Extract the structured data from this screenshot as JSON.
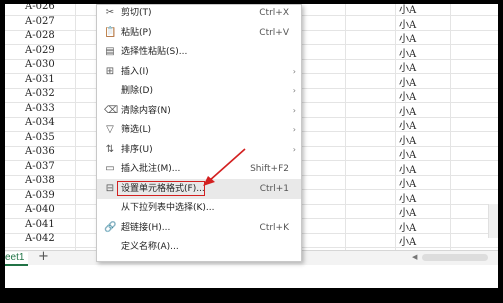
{
  "sheet": {
    "rows": [
      {
        "a": "A-026",
        "g": "小A"
      },
      {
        "a": "A-027",
        "g": "小A"
      },
      {
        "a": "A-028",
        "g": "小A"
      },
      {
        "a": "A-029",
        "g": "小A"
      },
      {
        "a": "A-030",
        "g": "小A"
      },
      {
        "a": "A-031",
        "g": "小A"
      },
      {
        "a": "A-032",
        "g": "小A"
      },
      {
        "a": "A-033",
        "g": "小A"
      },
      {
        "a": "A-034",
        "g": "小A"
      },
      {
        "a": "A-035",
        "g": "小A"
      },
      {
        "a": "A-036",
        "g": "小A"
      },
      {
        "a": "A-037",
        "g": "小A"
      },
      {
        "a": "A-038",
        "g": "小A"
      },
      {
        "a": "A-039",
        "g": "小A"
      },
      {
        "a": "A-040",
        "g": "小A"
      },
      {
        "a": "A-041",
        "g": "小A"
      },
      {
        "a": "A-042",
        "g": "小A"
      }
    ],
    "tab_label": "eet1",
    "add_sheet": "+"
  },
  "menu": {
    "items": [
      {
        "icon": "✂",
        "icon_name": "scissors-icon",
        "label": "剪切(T)",
        "shortcut": "Ctrl+X",
        "arrow": ""
      },
      {
        "icon": "📋",
        "icon_name": "clipboard-icon",
        "label": "粘贴(P)",
        "shortcut": "Ctrl+V",
        "arrow": ""
      },
      {
        "icon": "▤",
        "icon_name": "paste-special-icon",
        "label": "选择性粘贴(S)...",
        "shortcut": "",
        "arrow": ""
      },
      {
        "icon": "⊞",
        "icon_name": "insert-icon",
        "label": "插入(I)",
        "shortcut": "",
        "arrow": "›"
      },
      {
        "icon": "",
        "icon_name": "",
        "label": "删除(D)",
        "shortcut": "",
        "arrow": "›"
      },
      {
        "icon": "⌫",
        "icon_name": "clear-icon",
        "label": "清除内容(N)",
        "shortcut": "",
        "arrow": "›"
      },
      {
        "icon": "▽",
        "icon_name": "filter-icon",
        "label": "筛选(L)",
        "shortcut": "",
        "arrow": "›"
      },
      {
        "icon": "⇅",
        "icon_name": "sort-icon",
        "label": "排序(U)",
        "shortcut": "",
        "arrow": "›"
      },
      {
        "icon": "▭",
        "icon_name": "comment-icon",
        "label": "插入批注(M)...",
        "shortcut": "Shift+F2",
        "arrow": ""
      },
      {
        "icon": "⊟",
        "icon_name": "format-cells-icon",
        "label": "设置单元格格式(F)...",
        "shortcut": "Ctrl+1",
        "arrow": ""
      },
      {
        "icon": "",
        "icon_name": "",
        "label": "从下拉列表中选择(K)...",
        "shortcut": "",
        "arrow": ""
      },
      {
        "icon": "🔗",
        "icon_name": "link-icon",
        "label": "超链接(H)...",
        "shortcut": "Ctrl+K",
        "arrow": ""
      },
      {
        "icon": "",
        "icon_name": "",
        "label": "定义名称(A)...",
        "shortcut": "",
        "arrow": ""
      }
    ],
    "highlighted_index": 9
  },
  "colors": {
    "highlight_border": "#d32020",
    "sheet_tab_accent": "#217346"
  }
}
